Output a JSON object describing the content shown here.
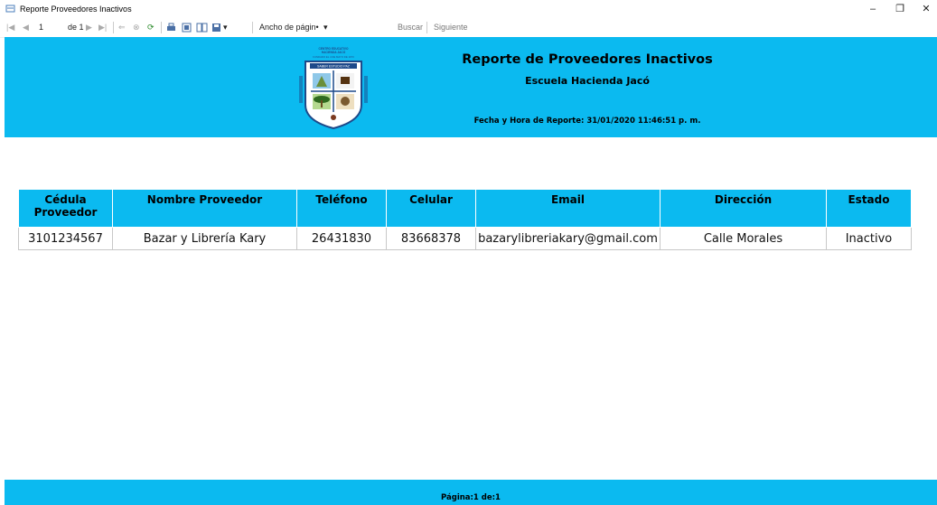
{
  "window": {
    "title": "Reporte Proveedores Inactivos"
  },
  "toolbar": {
    "page_current": "1",
    "page_of": "de 1",
    "zoom_value": "Ancho de págin•",
    "find_label": "Buscar",
    "next_label": "Siguiente"
  },
  "report": {
    "title": "Reporte de Proveedores Inactivos",
    "subtitle": "Escuela Hacienda Jacó",
    "datetime": "Fecha y Hora de Reporte: 31/01/2020 11:46:51 p. m.",
    "columns": [
      "Cédula Proveedor",
      "Nombre Proveedor",
      "Teléfono",
      "Celular",
      "Email",
      "Dirección",
      "Estado"
    ],
    "rows": [
      [
        "3101234567",
        "Bazar y Librería Kary",
        "26431830",
        "83668378",
        "bazarylibreriakary@gmail.com",
        "Calle Morales",
        "Inactivo"
      ]
    ],
    "footer": "Página:1 de:1"
  },
  "colors": {
    "header_bg": "#0bbaf0"
  }
}
